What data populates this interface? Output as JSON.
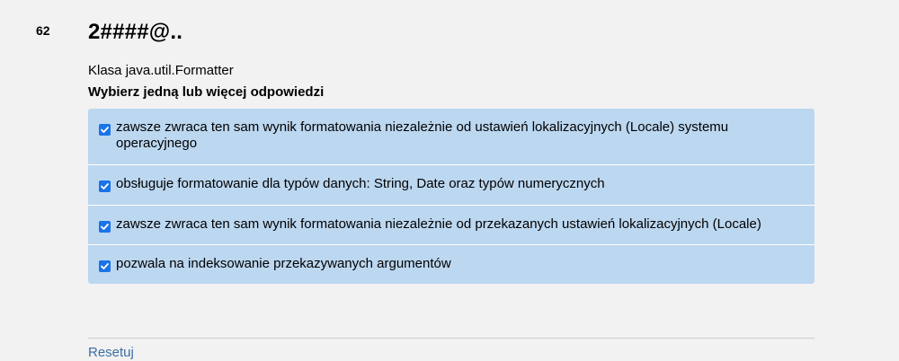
{
  "question": {
    "number": "62",
    "title": "2####@..",
    "text": "Klasa java.util.Formatter",
    "instruction": "Wybierz jedną lub więcej odpowiedzi"
  },
  "answers": [
    {
      "label": "zawsze zwraca ten sam wynik formatowania niezależnie od ustawień lokalizacyjnych (Locale) systemu operacyjnego",
      "checked": true
    },
    {
      "label": "obsługuje formatowanie dla typów danych: String, Date oraz typów numerycznych",
      "checked": true
    },
    {
      "label": "zawsze zwraca ten sam wynik formatowania niezależnie od przekazanych ustawień lokalizacyjnych (Locale)",
      "checked": true
    },
    {
      "label": "pozwala na indeksowanie przekazywanych argumentów",
      "checked": true
    }
  ],
  "footer": {
    "reset_label": "Resetuj"
  },
  "colors": {
    "accent": "#1a73e8",
    "answer_bg": "#bcd7f0",
    "link": "#3b6ea5"
  },
  "icons": {
    "checkbox": "checkbox-checked-icon"
  }
}
